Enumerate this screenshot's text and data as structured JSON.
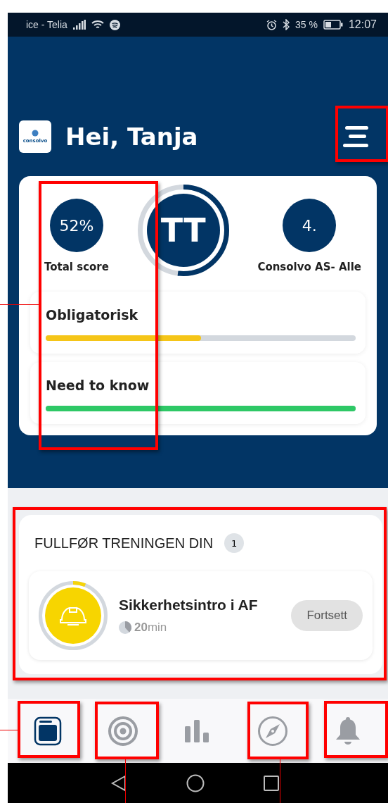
{
  "status_bar": {
    "carrier": "ice - Telia",
    "battery": "35 %",
    "time": "12:07"
  },
  "header": {
    "logo": "consolvo",
    "greeting": "Hei, Tanja"
  },
  "profile": {
    "score": "52%",
    "score_label": "Total score",
    "initials": "TT",
    "level": 0.52,
    "rank": "4.",
    "rank_label": "Consolvo AS- Alle"
  },
  "progress": [
    {
      "label": "Obligatorisk",
      "level": 0.5,
      "color": "#f5c518"
    },
    {
      "label": "Need to know",
      "level": 1,
      "color": "#2ec866"
    }
  ],
  "training": {
    "title": "FULLFØR TRENINGEN DIN",
    "count": "1",
    "courses": [
      {
        "name": "Sikkerhetsintro i AF",
        "duration": "20",
        "unit": "min",
        "level": 0.06,
        "button": "Fortsett"
      }
    ]
  },
  "nav": [
    {
      "kind": "home",
      "selected": true
    },
    {
      "kind": "target",
      "selected": false
    },
    {
      "kind": "stats",
      "selected": false
    },
    {
      "kind": "compass",
      "selected": false
    },
    {
      "kind": "bell",
      "selected": false
    }
  ],
  "annotations_shown": true
}
